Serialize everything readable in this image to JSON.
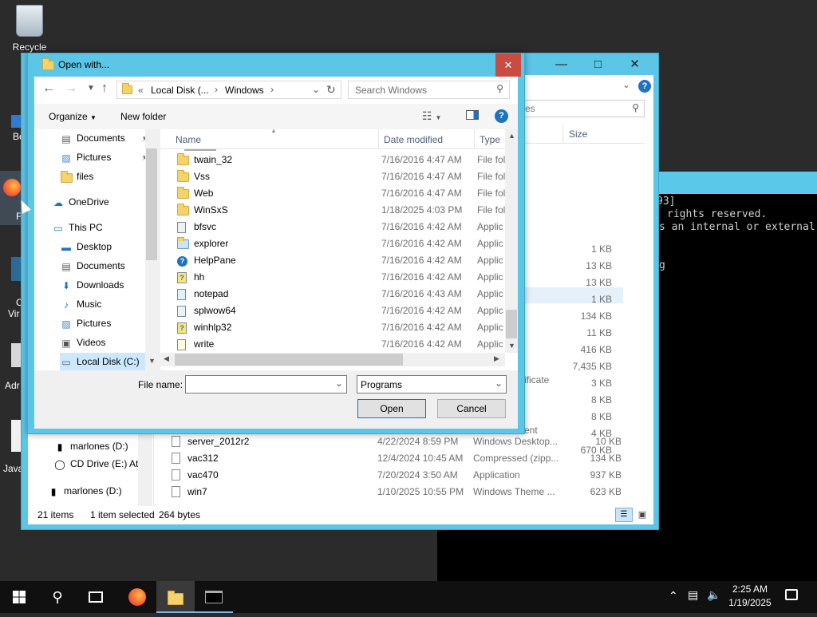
{
  "desktop": {
    "recycle_bin": "Recycle Bin",
    "partial_labels": [
      "Be",
      "F",
      "C",
      "Vir",
      "Adr",
      "Java"
    ]
  },
  "console": {
    "lines": [
      "93]",
      "rights reserved.",
      "s an internal or external",
      "g"
    ]
  },
  "explorer": {
    "search_placeholder": "es",
    "size_header": "Size",
    "nav": [
      {
        "label": "marlones (D:)",
        "icon": "usb-drive-icon"
      },
      {
        "label": "CD Drive (E:) Atl",
        "icon": "cd-drive-icon"
      },
      {
        "label": "marlones (D:)",
        "icon": "usb-drive-icon"
      }
    ],
    "sizes": [
      "1 KB",
      "13 KB",
      "13 KB",
      "1 KB",
      "134 KB",
      "11 KB",
      "416 KB",
      "7,435 KB",
      "3 KB",
      "8 KB",
      "8 KB",
      "4 KB",
      "670 KB"
    ],
    "partial_types": [
      "ificate",
      "ent"
    ],
    "rows": [
      {
        "name": "server_2012r2",
        "date": "4/22/2024 8:59 PM",
        "type": "Windows Desktop...",
        "size": "10 KB"
      },
      {
        "name": "vac312",
        "date": "12/4/2024 10:45 AM",
        "type": "Compressed (zipp...",
        "size": "134 KB"
      },
      {
        "name": "vac470",
        "date": "7/20/2024 3:50 AM",
        "type": "Application",
        "size": "937 KB"
      },
      {
        "name": "win7",
        "date": "1/10/2025 10:55 PM",
        "type": "Windows Theme ...",
        "size": "623 KB"
      }
    ],
    "status": {
      "items": "21 items",
      "selected": "1 item selected",
      "bytes": "264 bytes"
    }
  },
  "dialog": {
    "title": "Open with...",
    "close": "✕",
    "breadcrumb": {
      "prefix": "«",
      "parts": [
        "Local Disk (...",
        "Windows"
      ]
    },
    "search_placeholder": "Search Windows",
    "organize": "Organize",
    "new_folder": "New folder",
    "help": "?",
    "tree": [
      {
        "label": "Documents",
        "icon": "documents-icon",
        "pinned": true
      },
      {
        "label": "Pictures",
        "icon": "pictures-icon",
        "pinned": true
      },
      {
        "label": "files",
        "icon": "folder-icon",
        "pinned": false
      },
      {
        "label": "OneDrive",
        "icon": "onedrive-icon",
        "pinned": false
      },
      {
        "label": "This PC",
        "icon": "this-pc-icon",
        "pinned": false
      },
      {
        "label": "Desktop",
        "icon": "desktop-icon",
        "pinned": false
      },
      {
        "label": "Documents",
        "icon": "documents-icon",
        "pinned": false
      },
      {
        "label": "Downloads",
        "icon": "downloads-icon",
        "pinned": false
      },
      {
        "label": "Music",
        "icon": "music-icon",
        "pinned": false
      },
      {
        "label": "Pictures",
        "icon": "pictures-icon",
        "pinned": false
      },
      {
        "label": "Videos",
        "icon": "videos-icon",
        "pinned": false
      },
      {
        "label": "Local Disk (C:)",
        "icon": "local-disk-icon",
        "pinned": false
      }
    ],
    "columns": {
      "name": "Name",
      "date": "Date modified",
      "type": "Type"
    },
    "files": [
      {
        "name": "twain_32",
        "date": "7/16/2016 4:47 AM",
        "type": "File fol",
        "icon": "folder"
      },
      {
        "name": "Vss",
        "date": "7/16/2016 4:47 AM",
        "type": "File fol",
        "icon": "folder"
      },
      {
        "name": "Web",
        "date": "7/16/2016 4:47 AM",
        "type": "File fol",
        "icon": "folder"
      },
      {
        "name": "WinSxS",
        "date": "1/18/2025 4:03 PM",
        "type": "File fol",
        "icon": "folder"
      },
      {
        "name": "bfsvc",
        "date": "7/16/2016 4:42 AM",
        "type": "Applic",
        "icon": "app"
      },
      {
        "name": "explorer",
        "date": "7/16/2016 4:42 AM",
        "type": "Applic",
        "icon": "explorer"
      },
      {
        "name": "HelpPane",
        "date": "7/16/2016 4:42 AM",
        "type": "Applic",
        "icon": "help"
      },
      {
        "name": "hh",
        "date": "7/16/2016 4:42 AM",
        "type": "Applic",
        "icon": "hh"
      },
      {
        "name": "notepad",
        "date": "7/16/2016 4:43 AM",
        "type": "Applic",
        "icon": "notepad"
      },
      {
        "name": "splwow64",
        "date": "7/16/2016 4:42 AM",
        "type": "Applic",
        "icon": "app"
      },
      {
        "name": "winhlp32",
        "date": "7/16/2016 4:42 AM",
        "type": "Applic",
        "icon": "hh"
      },
      {
        "name": "write",
        "date": "7/16/2016 4:42 AM",
        "type": "Applic",
        "icon": "write"
      }
    ],
    "file_name_label": "File name:",
    "file_name_value": "",
    "filter_value": "Programs",
    "open": "Open",
    "cancel": "Cancel"
  },
  "taskbar": {
    "time": "2:25 AM",
    "date": "1/19/2025"
  }
}
